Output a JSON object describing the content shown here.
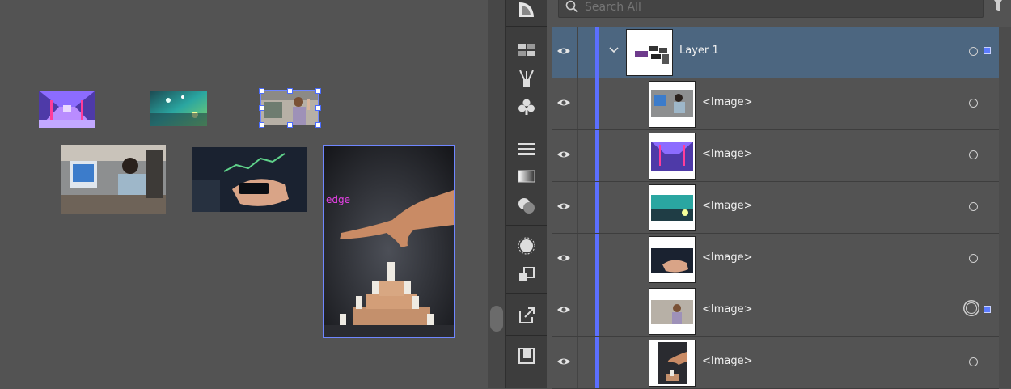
{
  "canvas": {
    "edge_label": "edge"
  },
  "layers_panel": {
    "search_placeholder": "Search All",
    "layer": {
      "name": "Layer 1",
      "expanded": true,
      "visible": true,
      "targeted": true,
      "color": "#5b6fff"
    },
    "items": [
      {
        "label": "<Image>",
        "visible": true,
        "thumb": "office-workers-photo",
        "targeted": false
      },
      {
        "label": "<Image>",
        "visible": true,
        "thumb": "purple-neon-corridor-photo",
        "targeted": false
      },
      {
        "label": "<Image>",
        "visible": true,
        "thumb": "teal-lights-room-photo",
        "targeted": false
      },
      {
        "label": "<Image>",
        "visible": true,
        "thumb": "hands-phone-chart-photo",
        "targeted": false
      },
      {
        "label": "<Image>",
        "visible": true,
        "thumb": "woman-waving-photo",
        "targeted": true
      },
      {
        "label": "<Image>",
        "visible": true,
        "thumb": "chess-hand-photo",
        "targeted": false
      }
    ]
  },
  "colors": {
    "selection": "#5b6fff",
    "layer_highlight": "#4c6680",
    "edge_label": "#e641e6"
  }
}
